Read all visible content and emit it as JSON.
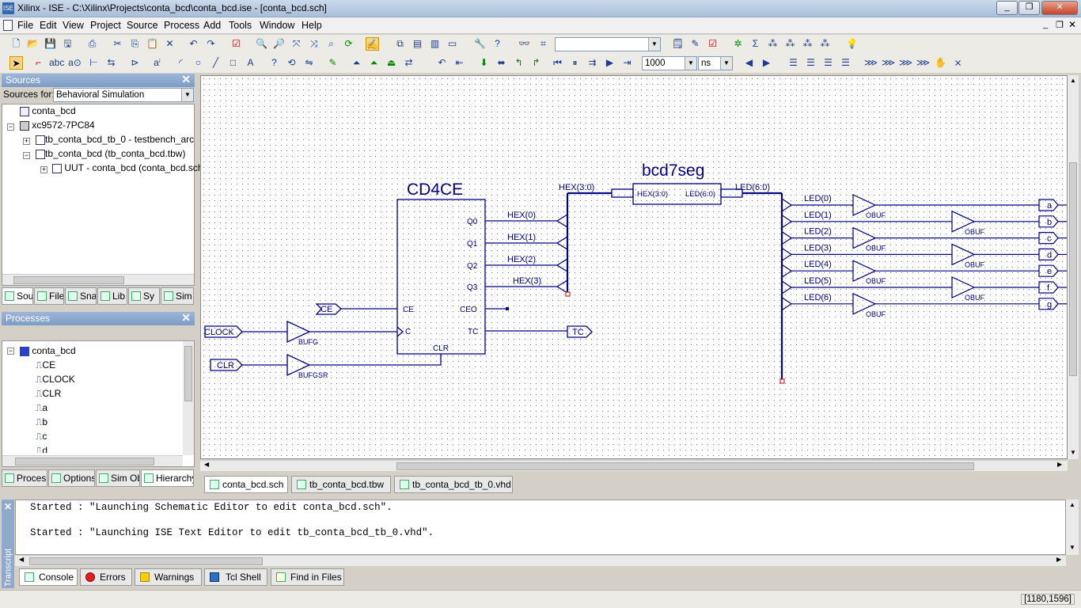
{
  "window": {
    "title": "Xilinx - ISE - C:\\Xilinx\\Projects\\conta_bcd\\conta_bcd.ise - [conta_bcd.sch]",
    "minimize": "_",
    "restore": "❐",
    "close": "✕"
  },
  "menu": [
    "File",
    "Edit",
    "View",
    "Project",
    "Source",
    "Process",
    "Add",
    "Tools",
    "Window",
    "Help"
  ],
  "toolbar": {
    "search_value": "",
    "zoom_value": "1000",
    "unit_value": "ns"
  },
  "sources": {
    "title": "Sources",
    "sources_for_label": "Sources for:",
    "sources_for_value": "Behavioral Simulation",
    "tree": [
      "conta_bcd",
      "xc9572-7PC84",
      "tb_conta_bcd_tb_0 - testbench_arch (t",
      "tb_conta_bcd (tb_conta_bcd.tbw)",
      "UUT - conta_bcd (conta_bcd.sch)"
    ],
    "tabs": [
      "Sou",
      "File",
      "Sna",
      "Lib",
      "Sy",
      "Sim"
    ]
  },
  "processes": {
    "title": "Processes",
    "root": "conta_bcd",
    "items": [
      "CE",
      "CLOCK",
      "CLR",
      "a",
      "b",
      "c",
      "d"
    ],
    "tabs": [
      "Proces",
      "Options",
      "Sim Ob",
      "Hierarchy"
    ]
  },
  "schematic": {
    "counter": {
      "name": "CD4CE",
      "pins_left": [
        "CE",
        "C",
        "CLR"
      ],
      "pins_right": [
        "Q0",
        "Q1",
        "Q2",
        "Q3",
        "CEO",
        "TC"
      ]
    },
    "decoder": {
      "name": "bcd7seg",
      "in_pin": "HEX(3:0)",
      "out_pin": "LED(6:0)"
    },
    "bus_hex": "HEX(3:0)",
    "bus_led": "LED(6:0)",
    "hex_nets": [
      "HEX(0)",
      "HEX(1)",
      "HEX(2)",
      "HEX(3)"
    ],
    "led_nets": [
      "LED(0)",
      "LED(1)",
      "LED(2)",
      "LED(3)",
      "LED(4)",
      "LED(5)",
      "LED(6)"
    ],
    "obuf_label": "OBUF",
    "outputs": [
      "a",
      "b",
      "c",
      "d",
      "e",
      "f",
      "g"
    ],
    "inputs": {
      "ce": "CE",
      "clock": "CLOCK",
      "clr": "CLR"
    },
    "tc_output": "TC",
    "bufg": "BUFG",
    "bufgsr": "BUFGSR"
  },
  "doc_tabs": [
    "conta_bcd.sch",
    "tb_conta_bcd.tbw",
    "tb_conta_bcd_tb_0.vhd"
  ],
  "console": {
    "side_label": "Transcript",
    "lines": [
      "Started : \"Launching Schematic Editor to edit conta_bcd.sch\".",
      "Started : \"Launching ISE Text Editor to edit tb_conta_bcd_tb_0.vhd\"."
    ],
    "tabs": [
      "Console",
      "Errors",
      "Warnings",
      "Tcl Shell",
      "Find in Files"
    ]
  },
  "status": {
    "coords": "[1180,1596]"
  },
  "colors": {
    "wire": "#000080",
    "title_grad": "#a9bfd9",
    "panel_header": "#7d9cc4"
  }
}
